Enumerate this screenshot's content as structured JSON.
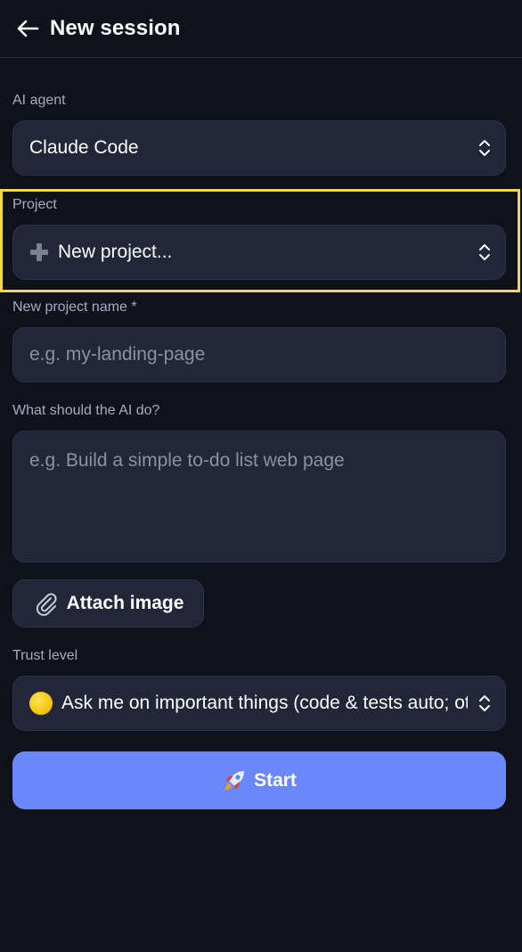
{
  "header": {
    "title": "New session"
  },
  "agent": {
    "label": "AI agent",
    "value": "Claude Code"
  },
  "project": {
    "label": "Project",
    "value": "New project..."
  },
  "project_name": {
    "label": "New project name *",
    "placeholder": "e.g. my-landing-page"
  },
  "task": {
    "label": "What should the AI do?",
    "placeholder": "e.g. Build a simple to-do list web page"
  },
  "attach": {
    "label": "Attach image",
    "icon": "paperclip-icon"
  },
  "trust": {
    "label": "Trust level",
    "value": "Ask me on important things (code & tests auto; other changes ask)",
    "icon": "yellow-circle-icon"
  },
  "start": {
    "label": "Start",
    "icon": "rocket-icon"
  },
  "colors": {
    "background": "#10121b",
    "field": "#232638",
    "accent": "#6888fb",
    "highlight": "#f6d84a"
  }
}
